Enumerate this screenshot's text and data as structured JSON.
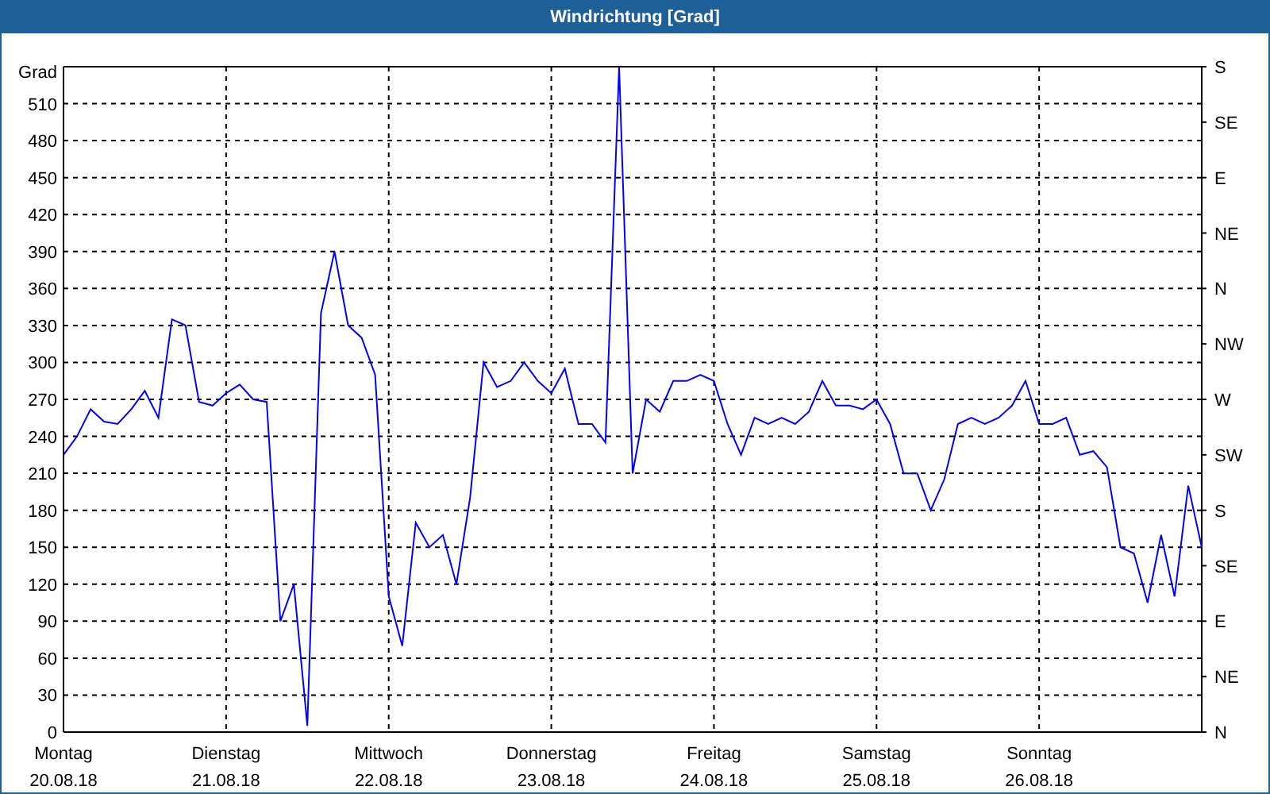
{
  "window": {
    "title": "Windrichtung [Grad]"
  },
  "chart": {
    "day_labels": [
      {
        "day": "Montag",
        "date": "20.08.18"
      },
      {
        "day": "Dienstag",
        "date": "21.08.18"
      },
      {
        "day": "Mittwoch",
        "date": "22.08.18"
      },
      {
        "day": "Donnerstag",
        "date": "23.08.18"
      },
      {
        "day": "Freitag",
        "date": "24.08.18"
      },
      {
        "day": "Samstag",
        "date": "25.08.18"
      },
      {
        "day": "Sonntag",
        "date": "26.08.18"
      }
    ],
    "compass_labels": [
      "S",
      "SE",
      "E",
      "NE",
      "N",
      "NW",
      "W",
      "SW",
      "S",
      "SE",
      "E",
      "NE",
      "N"
    ],
    "chart_data": {
      "type": "line",
      "grid": true,
      "ylabel": "Grad",
      "ylim": [
        0,
        540
      ],
      "yticks": [
        0,
        30,
        60,
        90,
        120,
        150,
        180,
        210,
        240,
        270,
        300,
        330,
        360,
        390,
        420,
        450,
        480,
        510
      ],
      "series": [
        {
          "color": "#0000ff",
          "values": [
            225,
            240,
            262,
            252,
            250,
            262,
            277,
            255,
            335,
            330,
            268,
            265,
            275,
            282,
            270,
            268,
            90,
            120,
            5,
            340,
            390,
            330,
            320,
            290,
            110,
            70,
            170,
            150,
            160,
            120,
            190,
            300,
            280,
            285,
            300,
            285,
            275,
            295,
            250,
            250,
            235,
            540,
            210,
            270,
            260,
            285,
            285,
            290,
            285,
            250,
            225,
            255,
            250,
            255,
            250,
            260,
            285,
            265,
            265,
            262,
            270,
            250,
            210,
            210,
            180,
            205,
            250,
            255,
            250,
            255,
            265,
            285,
            250,
            250,
            255,
            225,
            228,
            215,
            150,
            145,
            105,
            160,
            110,
            200,
            150
          ]
        }
      ]
    }
  }
}
